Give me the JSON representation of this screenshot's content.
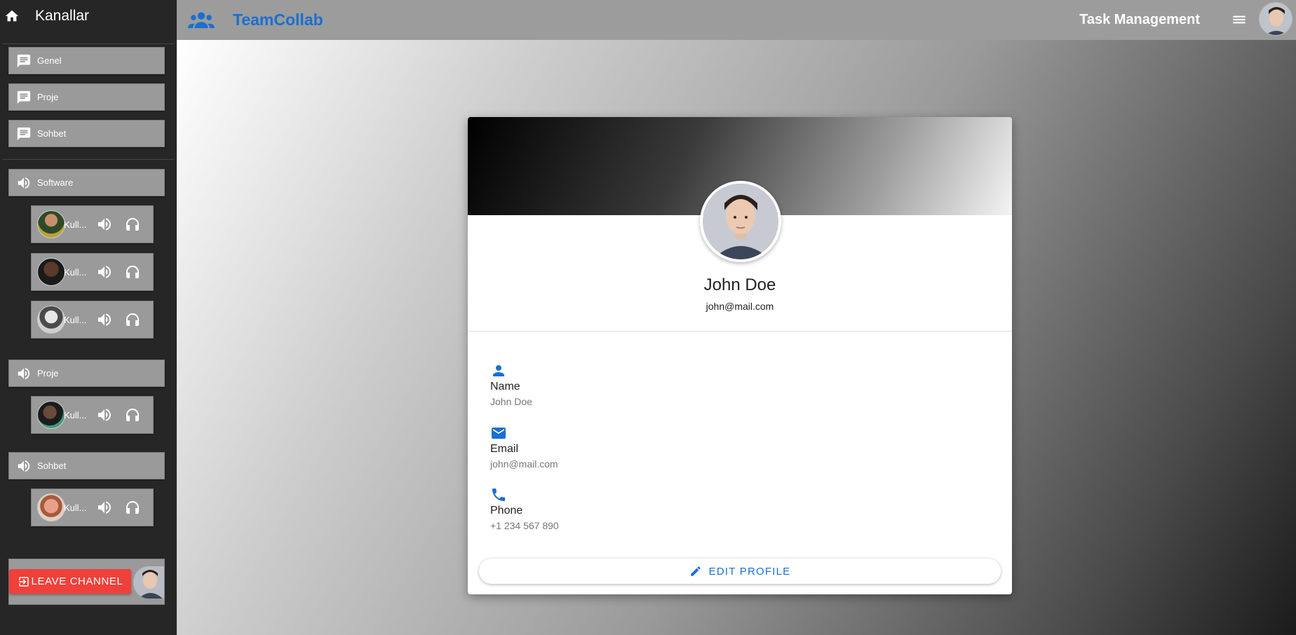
{
  "sidebar": {
    "title": "Kanallar",
    "text_channels": [
      {
        "label": "Genel"
      },
      {
        "label": "Proje"
      },
      {
        "label": "Sohbet"
      }
    ],
    "voice_channels": [
      {
        "label": "Software",
        "users": [
          {
            "name": "Kull..."
          },
          {
            "name": "Kull..."
          },
          {
            "name": "Kull..."
          }
        ]
      },
      {
        "label": "Proje",
        "users": [
          {
            "name": "Kull..."
          }
        ]
      },
      {
        "label": "Sohbet",
        "users": [
          {
            "name": "Kull..."
          }
        ]
      }
    ],
    "leave_button": "LEAVE CHANNEL"
  },
  "topbar": {
    "brand": "TeamCollab",
    "section": "Task Management"
  },
  "profile": {
    "name": "John Doe",
    "email": "john@mail.com",
    "fields": [
      {
        "icon": "person-icon",
        "label": "Name",
        "value": "John Doe"
      },
      {
        "icon": "email-icon",
        "label": "Email",
        "value": "john@mail.com"
      },
      {
        "icon": "phone-icon",
        "label": "Phone",
        "value": "+1 234 567 890"
      }
    ],
    "edit_button": "EDIT PROFILE"
  },
  "colors": {
    "accent": "#1a6fd1",
    "danger": "#f0403a",
    "sidebar_bg": "#262626",
    "item_bg": "#9a9a9a"
  }
}
